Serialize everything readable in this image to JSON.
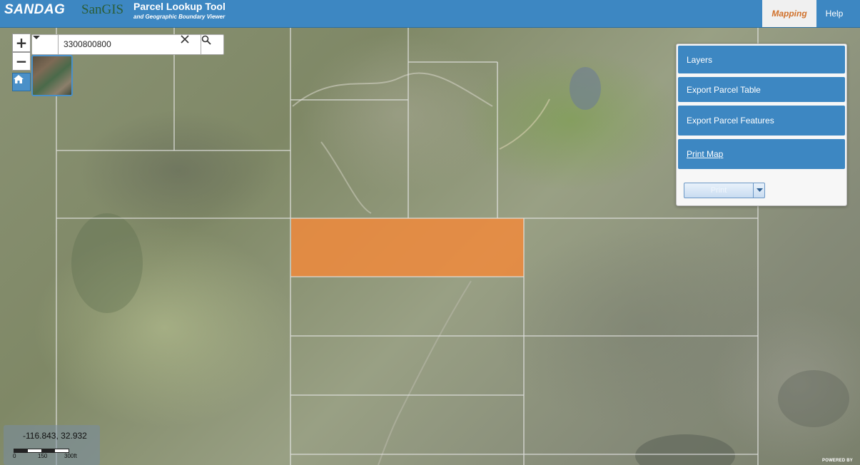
{
  "header": {
    "logo_sandag": "SANDAG",
    "logo_sangis": "SanGIS",
    "title": "Parcel Lookup Tool",
    "subtitle": "and Geographic Boundary Viewer",
    "nav": {
      "mapping": "Mapping",
      "help": "Help"
    },
    "accent_color": "#3d87c2",
    "active_nav_color": "#d0702a"
  },
  "map_controls": {
    "zoom_in": "+",
    "zoom_out": "−",
    "home_icon": "home-icon",
    "basemap_icon": "basemap-thumbnail"
  },
  "search": {
    "value": "3300800800",
    "dropdown_icon": "caret-down-icon",
    "clear_icon": "close-icon",
    "search_icon": "search-icon"
  },
  "panel": {
    "layers": "Layers",
    "export_table": "Export Parcel Table",
    "export_features": "Export Parcel Features",
    "print_map": "Print Map",
    "print_select": "Print"
  },
  "coordinates": "-116.843, 32.932",
  "scale": {
    "labels": [
      "0",
      "150",
      "300ft"
    ]
  },
  "footer": {
    "powered_by": "POWERED BY"
  },
  "selected_parcel_color": "#f08a3c"
}
